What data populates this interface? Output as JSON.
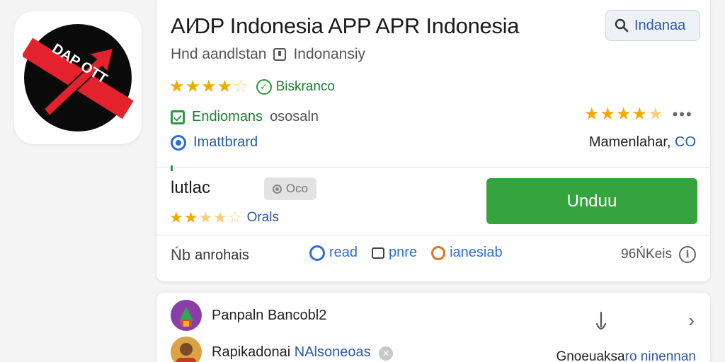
{
  "app": {
    "title": "AI⁄DP Indonesia APP APR Indonesia",
    "subtitle_left": "Hnd aandlstan",
    "subtitle_right": "Indonansiy",
    "icon_name": "red-arrow-app-icon",
    "icon_text": "DAP OTT"
  },
  "search": {
    "label": "Indanaa",
    "icon": "search-icon"
  },
  "rating": {
    "stars": 4.5,
    "badge_label": "Biskranco"
  },
  "features": {
    "primary_label": "Endiomans",
    "secondary_label": "ososaln",
    "right_rating": 4.5,
    "info_label": "Imattbrard"
  },
  "developer": {
    "label": "Mamenlahar,",
    "accent": "CO"
  },
  "install": {
    "section_label": "lutlac",
    "chip_label": "Oco",
    "rating": 3.5,
    "rating_label": "Orals",
    "button_label": "Unduu"
  },
  "actions": {
    "share_label": "anrohais",
    "share_prefix": "Ńb",
    "read_label": "read",
    "pnre_label": "pnre",
    "ianesiab_label": "ianesiab",
    "size_label": "96ŃKeis"
  },
  "dev_list": {
    "items": [
      {
        "name": "Panpaln",
        "handle": "Bancobl2"
      },
      {
        "name": "Rapikadonai",
        "handle": "NAlsoneoas"
      }
    ],
    "footer_prefix": "Gnoeuaksa",
    "footer_accent": "ro ninennan"
  },
  "colors": {
    "accent_blue": "#2a5aa7",
    "install_green": "#35a33e",
    "star_gold": "#f2a900",
    "verified_green": "#2c9a3f"
  }
}
